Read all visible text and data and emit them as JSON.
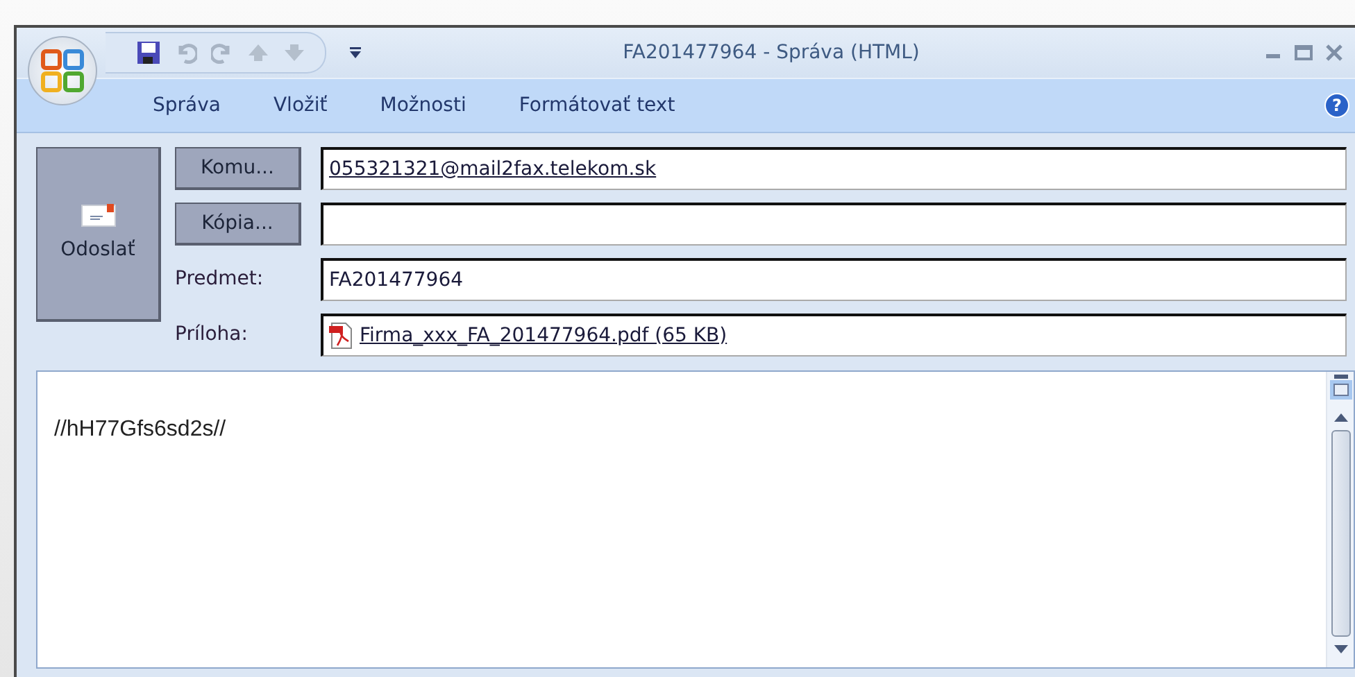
{
  "window": {
    "title": "FA201477964 - Správa (HTML)"
  },
  "tabs": [
    {
      "label": "Správa"
    },
    {
      "label": "Vložiť"
    },
    {
      "label": "Možnosti"
    },
    {
      "label": "Formátovať text"
    }
  ],
  "help_button": {
    "label": "?"
  },
  "send_button": {
    "label": "Odoslať"
  },
  "fields": [
    {
      "kind": "button",
      "label": "Komu...",
      "value": "055321321@mail2fax.telekom.sk"
    },
    {
      "kind": "button",
      "label": "Kópia..."
    },
    {
      "kind": "label",
      "label": "Predmet:",
      "value": "FA201477964"
    },
    {
      "kind": "attachment",
      "label": "Príloha:",
      "value": "Firma_xxx_FA_201477964.pdf (65 KB)"
    }
  ],
  "body": {
    "text": "//hH77Gfs6sd2s//"
  }
}
